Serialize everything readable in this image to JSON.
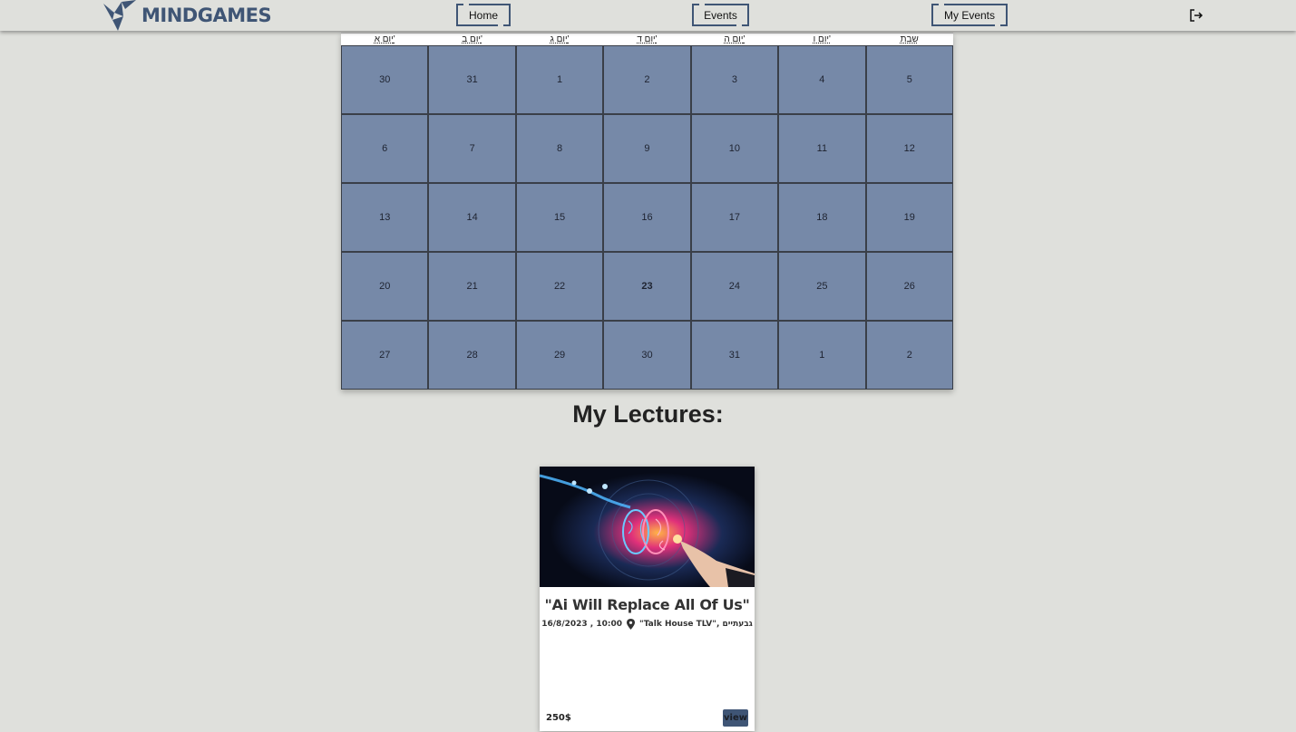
{
  "header": {
    "logo_text": "MINDGAMES",
    "logo_icon": "origami-bird-icon",
    "nav": {
      "home": "Home",
      "events": "Events",
      "my_events": "My Events"
    },
    "logout_icon": "logout-icon"
  },
  "calendar": {
    "weekdays": [
      "יום א'",
      "יום ב'",
      "יום ג'",
      "יום ד'",
      "יום ה'",
      "יום ו'",
      "שבת"
    ],
    "weeks": [
      [
        "30",
        "31",
        "1",
        "2",
        "3",
        "4",
        "5"
      ],
      [
        "6",
        "7",
        "8",
        "9",
        "10",
        "11",
        "12"
      ],
      [
        "13",
        "14",
        "15",
        "16",
        "17",
        "18",
        "19"
      ],
      [
        "20",
        "21",
        "22",
        "23",
        "24",
        "25",
        "26"
      ],
      [
        "27",
        "28",
        "29",
        "30",
        "31",
        "1",
        "2"
      ]
    ],
    "today": "23",
    "cell_color": "#7689a8"
  },
  "lectures": {
    "title": "My Lectures:",
    "items": [
      {
        "image": "ai-brain-illustration",
        "title": "\"Ai Will Replace All Of Us\"",
        "datetime": "16/8/2023 , 10:00",
        "location_icon": "map-pin-icon",
        "location": "\"Talk House TLV\", גבעתיים",
        "price": "250$",
        "view_label": "view"
      }
    ]
  },
  "colors": {
    "background": "#dfe0dc",
    "brand": "#3f5575"
  }
}
